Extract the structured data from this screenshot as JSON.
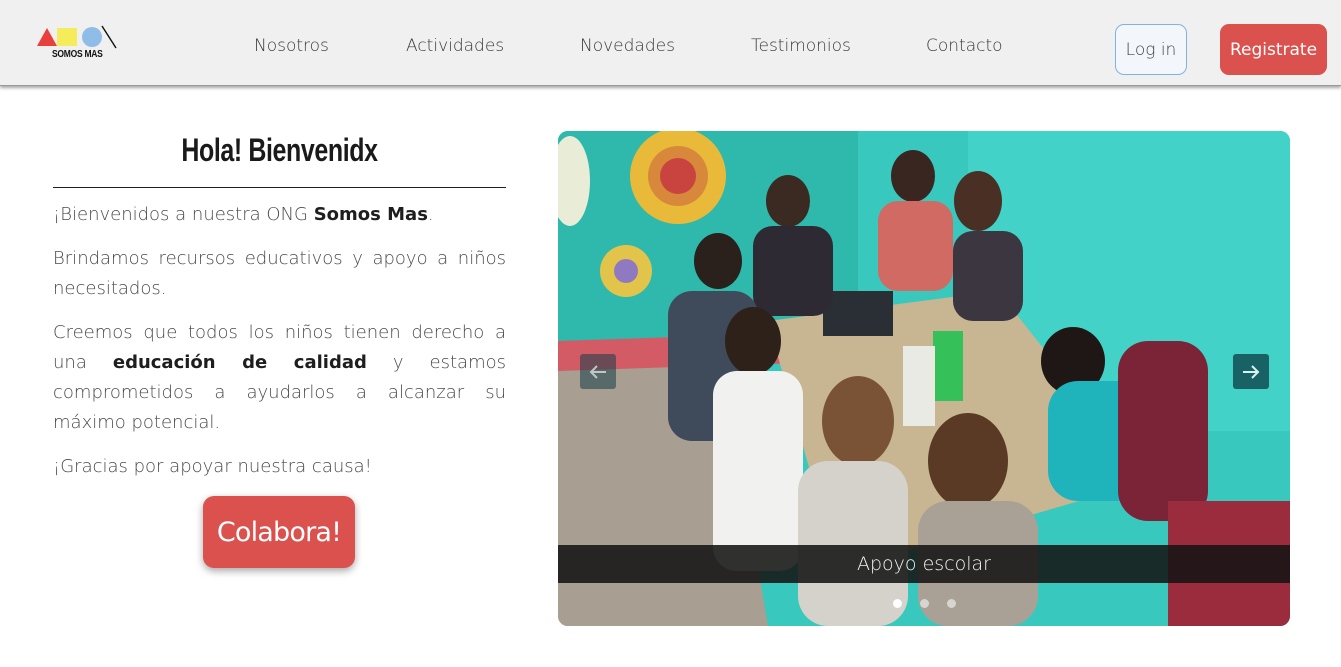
{
  "brand": {
    "name": "SOMOS MAS",
    "colors": {
      "triangle": "#e8403d",
      "square": "#f4ec5a",
      "circle": "#8fbde8"
    }
  },
  "nav": {
    "items": [
      "Nosotros",
      "Actividades",
      "Novedades",
      "Testimonios",
      "Contacto"
    ]
  },
  "auth": {
    "login_label": "Log in",
    "register_label": "Registrate"
  },
  "welcome": {
    "title": "Hola! Bienvenidx",
    "p1_pre": "¡Bienvenidos a nuestra ONG ",
    "p1_strong": "Somos Mas",
    "p1_post": ".",
    "p2": "Brindamos recursos educativos y apoyo a niños necesitados.",
    "p3_pre": "Creemos que todos los niños tienen derecho a una ",
    "p3_strong": "educación de calidad",
    "p3_post": " y estamos comprometidos a ayudarlos a alcanzar su máximo potencial.",
    "p4": "¡Gracias por apoyar nuestra causa!",
    "cta_label": "Colabora!"
  },
  "carousel": {
    "caption": "Apoyo escolar",
    "slide_count": 3,
    "active_index": 0,
    "icons": {
      "prev": "arrow-left-icon",
      "next": "arrow-right-icon"
    }
  },
  "colors": {
    "accent": "#da514d",
    "login_border": "#7fb2e8"
  }
}
